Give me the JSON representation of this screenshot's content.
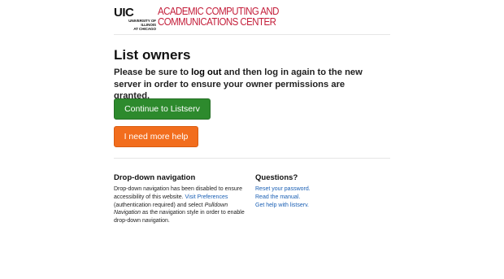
{
  "header": {
    "uic": "UIC",
    "university_line1": "UNIVERSITY OF ILLINOIS",
    "university_line2": "AT CHICAGO",
    "center_line1": "ACADEMIC COMPUTING AND",
    "center_line2": "COMMUNICATIONS CENTER"
  },
  "main": {
    "title": "List owners",
    "message_pre": "Please be sure to ",
    "message_bold": "log out",
    "message_post": " and then log in again to the new server in order to ensure your owner permissions are granted.",
    "continue_label": "Continue to Listserv",
    "help_label": "I need more help"
  },
  "footer": {
    "dropdown": {
      "heading": "Drop-down navigation",
      "text1": "Drop-down navigation has been disabled to ensure accessibility of this website. ",
      "link": "Visit Preferences",
      "text2": " (authentication required) and select ",
      "italic": "Pulldown Navigation",
      "text3": " as the navigation style in order to enable drop-down navigation."
    },
    "questions": {
      "heading": "Questions?",
      "links": [
        "Reset your password.",
        "Read the manual.",
        "Get help with listserv."
      ]
    }
  },
  "colors": {
    "brand_red": "#c41e3a",
    "continue_green": "#2d8a2d",
    "help_orange": "#f26d1d",
    "link_blue": "#1a5fb4"
  }
}
